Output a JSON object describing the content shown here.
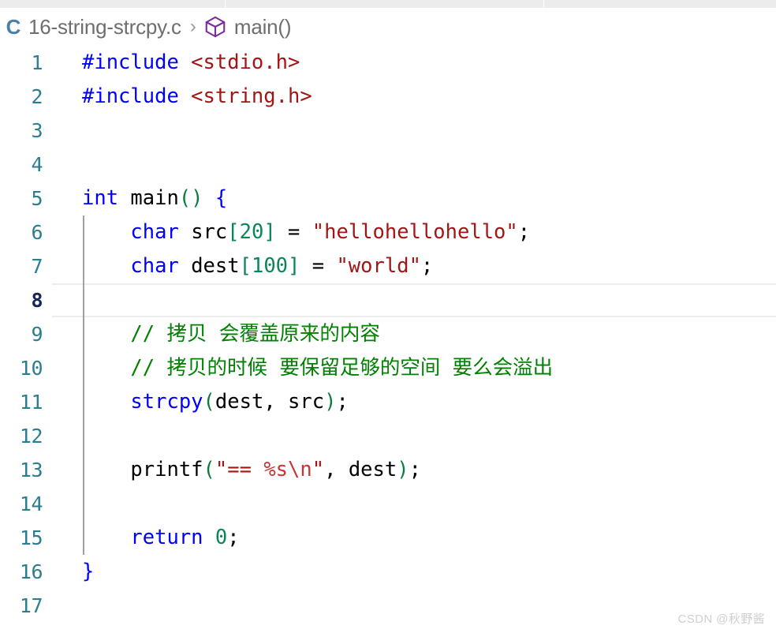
{
  "window": {
    "background": "#ffffff",
    "editor_group_strip": {
      "background": "#ececec",
      "cells": 3
    }
  },
  "breadcrumb": {
    "file_icon": "C",
    "file_icon_color": "#4a7fa5",
    "file_name": "16-string-strcpy.c",
    "separator": "›",
    "symbol_icon": "cube-icon",
    "symbol_icon_color": "#7b2d9e",
    "symbol_name": "main()",
    "text_color": "#6e6e6e"
  },
  "editor": {
    "language": "c",
    "active_line": 8,
    "line_number_color": "#2b7e8e",
    "active_line_number_color": "#10265c",
    "indent_guide_color": "#a0a0a0",
    "indent_guide_start_line": 6,
    "indent_guide_end_line": 15,
    "lines": [
      {
        "number": "1",
        "tokens": [
          {
            "t": "#include ",
            "c": "tk-preproc"
          },
          {
            "t": "<stdio.h>",
            "c": "tk-string"
          }
        ]
      },
      {
        "number": "2",
        "tokens": [
          {
            "t": "#include ",
            "c": "tk-preproc"
          },
          {
            "t": "<string.h>",
            "c": "tk-string"
          }
        ]
      },
      {
        "number": "3",
        "tokens": []
      },
      {
        "number": "4",
        "tokens": []
      },
      {
        "number": "5",
        "tokens": [
          {
            "t": "int",
            "c": "tk-keyword"
          },
          {
            "t": " main",
            "c": "tk-plain"
          },
          {
            "t": "()",
            "c": "tk-paren"
          },
          {
            "t": " ",
            "c": "tk-plain"
          },
          {
            "t": "{",
            "c": "tk-keyword"
          }
        ]
      },
      {
        "number": "6",
        "tokens": [
          {
            "t": "    ",
            "c": "tk-plain"
          },
          {
            "t": "char",
            "c": "tk-keyword"
          },
          {
            "t": " src",
            "c": "tk-plain"
          },
          {
            "t": "[",
            "c": "tk-bracket"
          },
          {
            "t": "20",
            "c": "tk-number"
          },
          {
            "t": "]",
            "c": "tk-bracket"
          },
          {
            "t": " = ",
            "c": "tk-op"
          },
          {
            "t": "\"hellohellohello\"",
            "c": "tk-string"
          },
          {
            "t": ";",
            "c": "tk-plain"
          }
        ]
      },
      {
        "number": "7",
        "tokens": [
          {
            "t": "    ",
            "c": "tk-plain"
          },
          {
            "t": "char",
            "c": "tk-keyword"
          },
          {
            "t": " dest",
            "c": "tk-plain"
          },
          {
            "t": "[",
            "c": "tk-bracket"
          },
          {
            "t": "100",
            "c": "tk-number"
          },
          {
            "t": "]",
            "c": "tk-bracket"
          },
          {
            "t": " = ",
            "c": "tk-op"
          },
          {
            "t": "\"world\"",
            "c": "tk-string"
          },
          {
            "t": ";",
            "c": "tk-plain"
          }
        ]
      },
      {
        "number": "8",
        "tokens": []
      },
      {
        "number": "9",
        "tokens": [
          {
            "t": "    ",
            "c": "tk-plain"
          },
          {
            "t": "// 拷贝 会覆盖原来的内容",
            "c": "tk-comment"
          }
        ]
      },
      {
        "number": "10",
        "tokens": [
          {
            "t": "    ",
            "c": "tk-plain"
          },
          {
            "t": "// 拷贝的时候 要保留足够的空间 要么会溢出",
            "c": "tk-comment"
          }
        ]
      },
      {
        "number": "11",
        "tokens": [
          {
            "t": "    ",
            "c": "tk-plain"
          },
          {
            "t": "strcpy",
            "c": "tk-func"
          },
          {
            "t": "(",
            "c": "tk-paren"
          },
          {
            "t": "dest, src",
            "c": "tk-plain"
          },
          {
            "t": ")",
            "c": "tk-paren"
          },
          {
            "t": ";",
            "c": "tk-plain"
          }
        ]
      },
      {
        "number": "12",
        "tokens": []
      },
      {
        "number": "13",
        "tokens": [
          {
            "t": "    ",
            "c": "tk-plain"
          },
          {
            "t": "printf",
            "c": "tk-plain"
          },
          {
            "t": "(",
            "c": "tk-paren"
          },
          {
            "t": "\"== ",
            "c": "tk-string"
          },
          {
            "t": "%s\\n",
            "c": "tk-strfmt"
          },
          {
            "t": "\"",
            "c": "tk-string"
          },
          {
            "t": ", dest",
            "c": "tk-plain"
          },
          {
            "t": ")",
            "c": "tk-paren"
          },
          {
            "t": ";",
            "c": "tk-plain"
          }
        ]
      },
      {
        "number": "14",
        "tokens": []
      },
      {
        "number": "15",
        "tokens": [
          {
            "t": "    ",
            "c": "tk-plain"
          },
          {
            "t": "return",
            "c": "tk-keyword"
          },
          {
            "t": " ",
            "c": "tk-plain"
          },
          {
            "t": "0",
            "c": "tk-number"
          },
          {
            "t": ";",
            "c": "tk-plain"
          }
        ]
      },
      {
        "number": "16",
        "tokens": [
          {
            "t": "}",
            "c": "tk-keyword"
          }
        ]
      },
      {
        "number": "17",
        "tokens": []
      }
    ]
  },
  "watermark": {
    "text": "CSDN @秋野酱"
  }
}
